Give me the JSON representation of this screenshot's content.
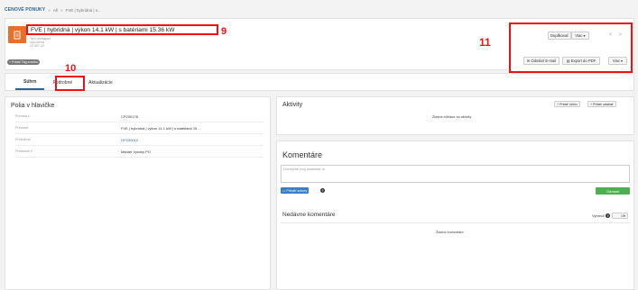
{
  "breadcrumb": {
    "root": "CENOVÉ PONUKY",
    "sep1": ">",
    "item1": "All",
    "sep2": ">",
    "item2": "FVE | hybridná | v..."
  },
  "header": {
    "title": "FVE | hybridná | výkon 14.1 kW | s batériami 15.36 kW",
    "meta1": "Test predajca1",
    "meta2": "Vytvorená",
    "meta3": "22 507.42",
    "tag_button": "+ Pridať Tag značku"
  },
  "annotations": {
    "a9": "9",
    "a10": "10",
    "a11": "11"
  },
  "actions": {
    "duplicate": "Duplikovať",
    "more1": "Viac",
    "prev": "<",
    "next": ">",
    "send_email": "Odoslať E-mail",
    "export_pdf": "Export do PDF",
    "more2": "Viac"
  },
  "tabs": [
    "Súhrn",
    "Podrobné",
    "Aktualizácie"
  ],
  "fields": {
    "title": "Polia v hlavičke",
    "rows": [
      {
        "label": "Ponuka č.",
        "value": "CP230178"
      },
      {
        "label": "Predmet",
        "value": "FVE | hybridná | výkon 14.1 kW | s batériami 15...."
      },
      {
        "label": "Príležitosť",
        "value": "OP230010"
      },
      {
        "label": "Pridelené k",
        "value": "Marián Vysoký PO"
      }
    ]
  },
  "activity": {
    "title": "Aktivity",
    "add_task": "+ Pridať úlohu",
    "add_event": "+ Pridať udalosť",
    "empty": "Žiadne blížiace sa aktivity"
  },
  "comments": {
    "title": "Komentáre",
    "placeholder": "Uverejnite svoj komentár tu",
    "attach": "Priložiť súbory",
    "info": "?",
    "send": "Odoslať",
    "recent_title": "Nedávne komentáre",
    "filter_label": "Vyhrnúť",
    "toggle": "Off",
    "empty": "Žiadne komentáre"
  },
  "colors": {
    "accent": "#2a6496",
    "record_icon": "#e8702a",
    "annotation": "#ee1111",
    "send": "#4caf50",
    "attach": "#3a7fc1"
  }
}
